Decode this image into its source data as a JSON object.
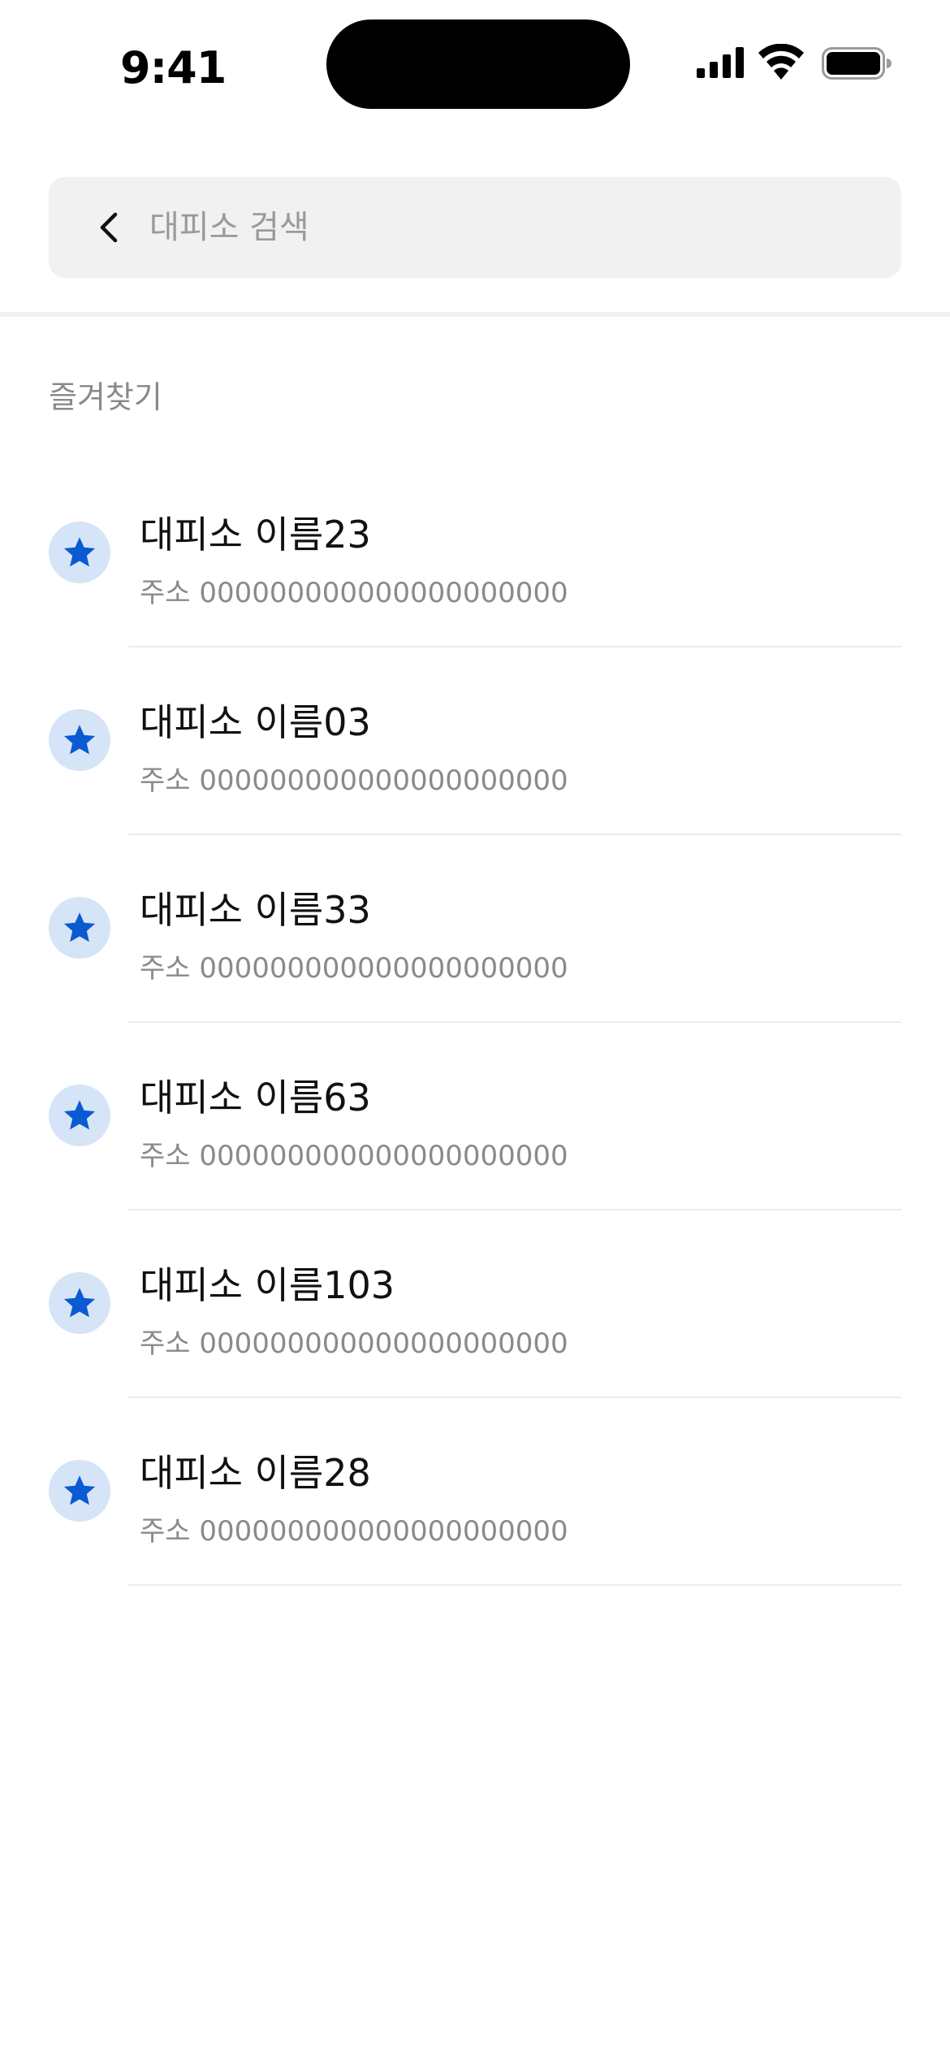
{
  "status_bar": {
    "time": "9:41",
    "icons": [
      "signal-icon",
      "wifi-icon",
      "battery-icon"
    ]
  },
  "search": {
    "placeholder": "대피소 검색",
    "value": "",
    "back_icon": "chevron-left-icon"
  },
  "favorites": {
    "title": "즐겨찾기",
    "item_icon": "star-icon",
    "items": [
      {
        "name": "대피소 이름23",
        "address": "주소 000000000000000000000"
      },
      {
        "name": "대피소 이름03",
        "address": "주소 000000000000000000000"
      },
      {
        "name": "대피소 이름33",
        "address": "주소 000000000000000000000"
      },
      {
        "name": "대피소 이름63",
        "address": "주소 000000000000000000000"
      },
      {
        "name": "대피소 이름103",
        "address": "주소 000000000000000000000"
      },
      {
        "name": "대피소 이름28",
        "address": "주소 000000000000000000000"
      }
    ]
  },
  "colors": {
    "accent": "#0a5ad2",
    "star_badge_bg": "#d6e4f7",
    "search_bg": "#f1f1f1",
    "secondary_text": "#8a8a8a"
  }
}
